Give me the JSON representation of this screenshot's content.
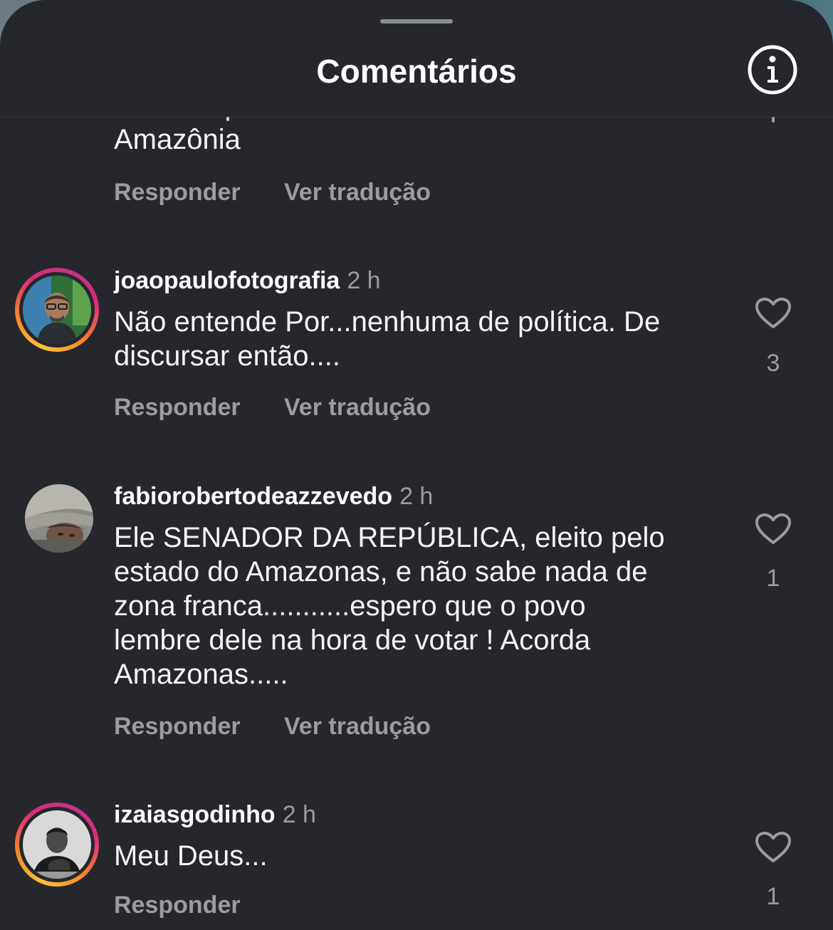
{
  "header": {
    "title": "Comentários"
  },
  "icons": {
    "info": "info-circle-icon",
    "like": "heart-outline-icon"
  },
  "colors": {
    "sheet_background": "#25272d",
    "secondary_text": "#9a9ca2",
    "story_ring": [
      "#f9c43a",
      "#f58529",
      "#dd2a7b",
      "#c13584"
    ]
  },
  "top_partial_comment": {
    "text_tail": "Amazônia",
    "reply_label": "Responder",
    "translate_label": "Ver tradução"
  },
  "comments": [
    {
      "username": "joaopaulofotografia",
      "time": "2 h",
      "text_lines": [
        "Não entende Por...nenhuma de política. De",
        "discursar então...."
      ],
      "likes": "3",
      "reply_label": "Responder",
      "translate_label": "Ver tradução",
      "has_story_ring": true
    },
    {
      "username": "fabiorobertodeazzevedo",
      "time": "2 h",
      "text_lines": [
        "Ele SENADOR DA REPÚBLICA, eleito pelo",
        "estado do Amazonas, e não sabe nada de",
        "zona franca...........espero que o povo",
        "lembre dele na hora de votar ! Acorda",
        "Amazonas....."
      ],
      "likes": "1",
      "reply_label": "Responder",
      "translate_label": "Ver tradução",
      "has_story_ring": false
    },
    {
      "username": "izaiasgodinho",
      "time": "2 h",
      "text_lines": [
        "Meu Deus..."
      ],
      "likes": "1",
      "reply_label": "Responder",
      "has_story_ring": true
    }
  ]
}
